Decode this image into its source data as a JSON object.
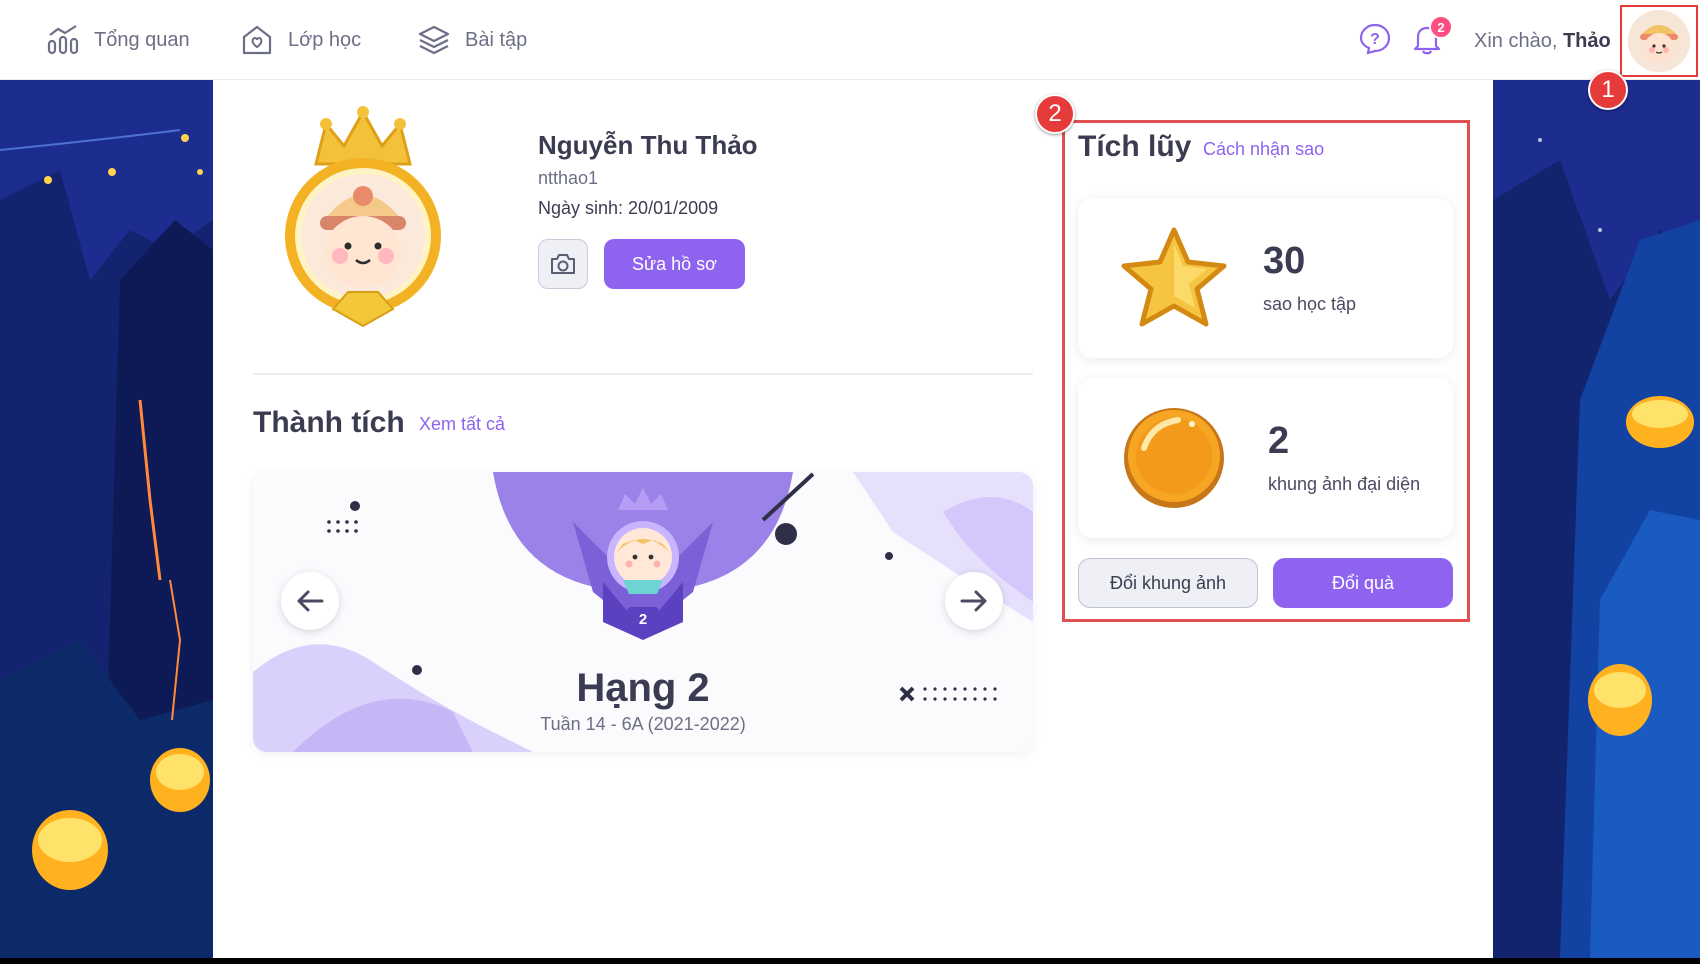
{
  "nav": {
    "items": [
      {
        "label": "Tổng quan",
        "icon": "chart-icon"
      },
      {
        "label": "Lớp học",
        "icon": "home-heart-icon"
      },
      {
        "label": "Bài tập",
        "icon": "layers-icon"
      }
    ]
  },
  "header": {
    "notification_count": "2",
    "greeting_prefix": "Xin chào,",
    "user_first_name": "Thảo"
  },
  "markers": {
    "one": "1",
    "two": "2"
  },
  "profile": {
    "name": "Nguyễn Thu Thảo",
    "username": "ntthao1",
    "dob": "Ngày sinh: 20/01/2009",
    "edit_label": "Sửa hồ sơ"
  },
  "achievements": {
    "title": "Thành tích",
    "view_all": "Xem tất cả",
    "rank_badge_number": "2",
    "rank_title": "Hạng 2",
    "rank_subtitle": "Tuần 14 - 6A (2021-2022)"
  },
  "accumulation": {
    "title": "Tích lũy",
    "how_link": "Cách nhận sao",
    "stars_value": "30",
    "stars_label": "sao học tập",
    "frames_value": "2",
    "frames_label": "khung ảnh đại diện",
    "change_frame_label": "Đổi khung ảnh",
    "redeem_label": "Đổi quà"
  },
  "colors": {
    "accent": "#8d63f0",
    "marker_red": "#e53b3b",
    "badge_pink": "#ff4f82"
  }
}
